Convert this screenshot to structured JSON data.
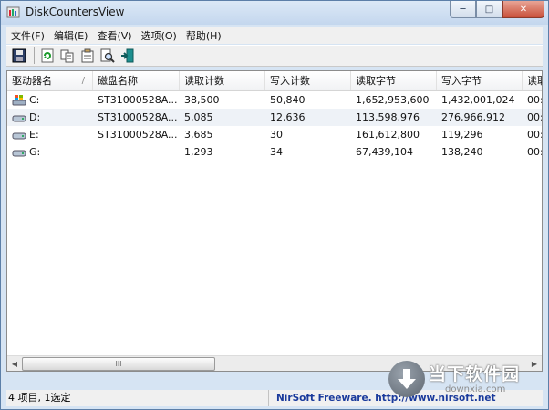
{
  "window": {
    "title": "DiskCountersView"
  },
  "menu": [
    "文件(F)",
    "编辑(E)",
    "查看(V)",
    "选项(O)",
    "帮助(H)"
  ],
  "toolbar": [
    "save-icon",
    "refresh-icon",
    "copy-icon",
    "properties-icon",
    "find-icon",
    "exit-icon"
  ],
  "table": {
    "columns": [
      "驱动器名",
      "磁盘名称",
      "读取计数",
      "写入计数",
      "读取字节",
      "写入字节",
      "读取"
    ],
    "sort_indicator": "/",
    "rows": [
      {
        "drive": "C:",
        "disk": "ST31000528A...",
        "reads": "38,500",
        "writes": "50,840",
        "read_bytes": "1,652,953,600",
        "write_bytes": "1,432,001,024",
        "extra": "00:"
      },
      {
        "drive": "D:",
        "disk": "ST31000528A...",
        "reads": "5,085",
        "writes": "12,636",
        "read_bytes": "113,598,976",
        "write_bytes": "276,966,912",
        "extra": "00:"
      },
      {
        "drive": "E:",
        "disk": "ST31000528A...",
        "reads": "3,685",
        "writes": "30",
        "read_bytes": "161,612,800",
        "write_bytes": "119,296",
        "extra": "00:"
      },
      {
        "drive": "G:",
        "disk": "",
        "reads": "1,293",
        "writes": "34",
        "read_bytes": "67,439,104",
        "write_bytes": "138,240",
        "extra": "00:"
      }
    ]
  },
  "scrollbar": {
    "grip": "III"
  },
  "status": {
    "left": "4 项目, 1选定",
    "right": "NirSoft Freeware.  http://www.nirsoft.net"
  },
  "watermark": {
    "text": "当下软件园",
    "sub": "downxia.com"
  }
}
